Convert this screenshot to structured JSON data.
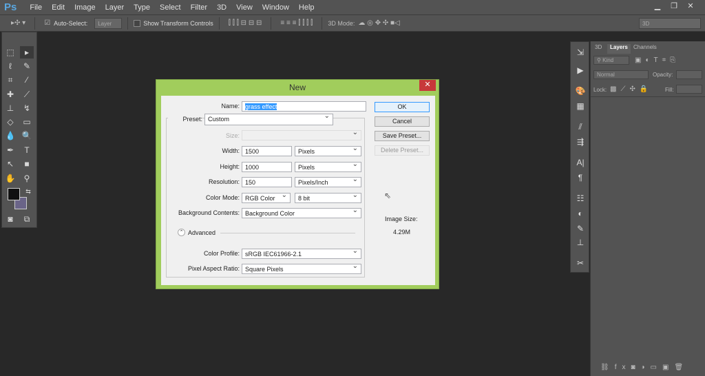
{
  "app": {
    "logo": "Ps",
    "menu": [
      "File",
      "Edit",
      "Image",
      "Layer",
      "Type",
      "Select",
      "Filter",
      "3D",
      "View",
      "Window",
      "Help"
    ]
  },
  "options": {
    "auto_select": "Auto-Select:",
    "layer_select": "Layer",
    "show_transform": "Show Transform Controls",
    "mode3d": "3D Mode:",
    "workspace": "3D"
  },
  "layers_panel": {
    "tabs": [
      "3D",
      "Layers",
      "Channels"
    ],
    "kind": "Kind",
    "blend": "Normal",
    "opacity": "Opacity:",
    "lock": "Lock:",
    "fill": "Fill:"
  },
  "colors": {
    "foreground": "#111111",
    "background": "#6a6488",
    "accent": "#a1cd5c"
  },
  "dialog": {
    "title": "New",
    "name_label": "Name:",
    "name_value": "grass effect",
    "preset_label": "Preset:",
    "preset_value": "Custom",
    "size_label": "Size:",
    "width_label": "Width:",
    "width_value": "1500",
    "width_unit": "Pixels",
    "height_label": "Height:",
    "height_value": "1000",
    "height_unit": "Pixels",
    "resolution_label": "Resolution:",
    "resolution_value": "150",
    "resolution_unit": "Pixels/Inch",
    "color_mode_label": "Color Mode:",
    "color_mode_value": "RGB Color",
    "bit_depth": "8 bit",
    "bg_label": "Background Contents:",
    "bg_value": "Background Color",
    "advanced": "Advanced",
    "profile_label": "Color Profile:",
    "profile_value": "sRGB IEC61966-2.1",
    "par_label": "Pixel Aspect Ratio:",
    "par_value": "Square Pixels",
    "ok": "OK",
    "cancel": "Cancel",
    "save_preset": "Save Preset...",
    "delete_preset": "Delete Preset...",
    "image_size_label": "Image Size:",
    "image_size_value": "4.29M"
  }
}
